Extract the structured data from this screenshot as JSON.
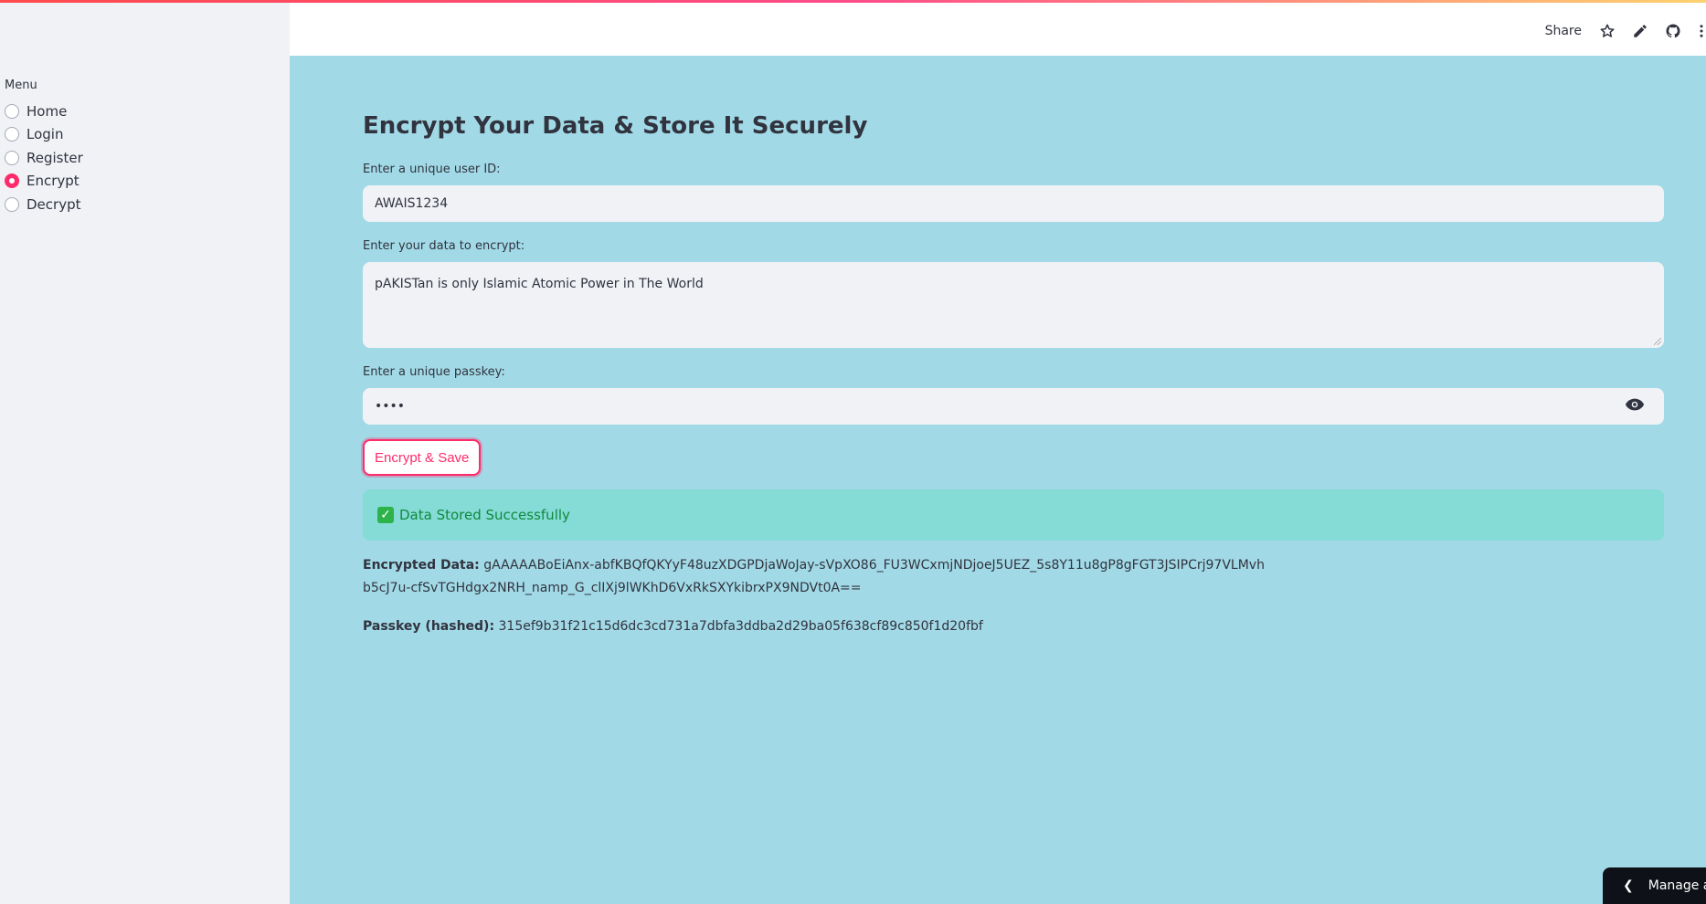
{
  "sidebar": {
    "menu_label": "Menu",
    "items": [
      {
        "label": "Home",
        "checked": false
      },
      {
        "label": "Login",
        "checked": false
      },
      {
        "label": "Register",
        "checked": false
      },
      {
        "label": "Encrypt",
        "checked": true
      },
      {
        "label": "Decrypt",
        "checked": false
      }
    ]
  },
  "header": {
    "share_label": "Share",
    "icons": [
      "star-icon",
      "pencil-icon",
      "github-icon",
      "more-vertical-icon"
    ]
  },
  "main": {
    "title": "Encrypt Your Data & Store It Securely",
    "user_id_label": "Enter a unique user ID:",
    "user_id_value": "AWAIS1234",
    "data_label": "Enter your data to encrypt:",
    "data_value": "pAKISTan is only Islamic Atomic Power in The World",
    "passkey_label": "Enter a unique passkey:",
    "passkey_value": "••••",
    "button_label": "Encrypt & Save",
    "alert_text": "Data Stored Successfully",
    "encrypted_label": "Encrypted Data:",
    "encrypted_value": "gAAAAABoEiAnx-abfKBQfQKYyF48uzXDGPDjaWoJay-sVpXO86_FU3WCxmjNDjoeJ5UEZ_5s8Y11u8gP8gFGT3JSIPCrj97VLMvhb5cJ7u-cfSvTGHdgx2NRH_namp_G_clIXj9lWKhD6VxRkSXYkibrxPX9NDVt0A==",
    "passkey_hashed_label": "Passkey (hashed):",
    "passkey_hashed_value": "315ef9b31f21c15d6dc3cd731a7dbfa3ddba2d29ba05f638cf89c850f1d20fbf"
  },
  "footer": {
    "manage_label": "Manage app"
  },
  "colors": {
    "accent": "#ff2b6a",
    "main_bg": "#a1dae6",
    "sidebar_bg": "#f0f2f6",
    "success_bg": "#85dbd6"
  }
}
